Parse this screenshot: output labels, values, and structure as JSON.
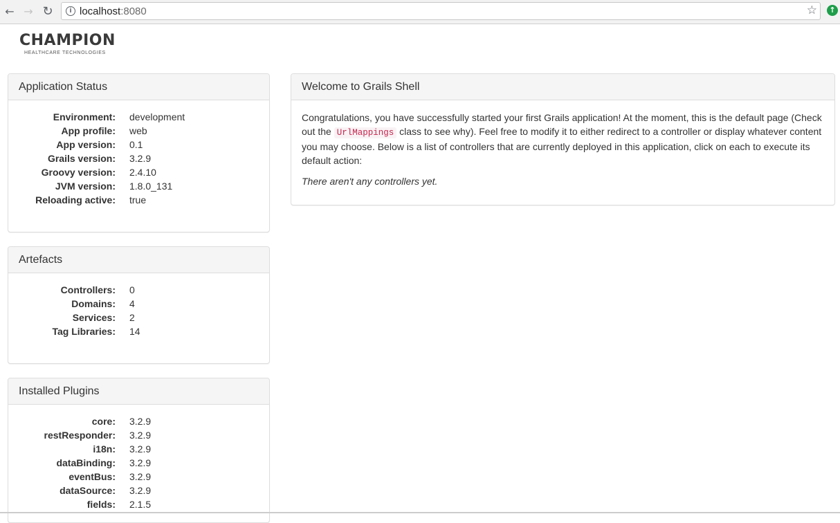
{
  "browser": {
    "url_host": "localhost",
    "url_port": ":8080",
    "back_icon": "←",
    "forward_icon": "→",
    "reload_icon": "↻",
    "info_icon": "i",
    "star_icon": "☆",
    "extension_icon": "↑"
  },
  "logo": {
    "name": "CHAMPION",
    "tagline": "HEALTHCARE TECHNOLOGIES"
  },
  "application_status": {
    "title": "Application Status",
    "items": [
      {
        "label": "Environment:",
        "value": "development"
      },
      {
        "label": "App profile:",
        "value": "web"
      },
      {
        "label": "App version:",
        "value": "0.1"
      },
      {
        "label": "Grails version:",
        "value": "3.2.9"
      },
      {
        "label": "Groovy version:",
        "value": "2.4.10"
      },
      {
        "label": "JVM version:",
        "value": "1.8.0_131"
      },
      {
        "label": "Reloading active:",
        "value": "true"
      }
    ]
  },
  "artefacts": {
    "title": "Artefacts",
    "items": [
      {
        "label": "Controllers:",
        "value": "0"
      },
      {
        "label": "Domains:",
        "value": "4"
      },
      {
        "label": "Services:",
        "value": "2"
      },
      {
        "label": "Tag Libraries:",
        "value": "14"
      }
    ]
  },
  "installed_plugins": {
    "title": "Installed Plugins",
    "items": [
      {
        "label": "core:",
        "value": "3.2.9"
      },
      {
        "label": "restResponder:",
        "value": "3.2.9"
      },
      {
        "label": "i18n:",
        "value": "3.2.9"
      },
      {
        "label": "dataBinding:",
        "value": "3.2.9"
      },
      {
        "label": "eventBus:",
        "value": "3.2.9"
      },
      {
        "label": "dataSource:",
        "value": "3.2.9"
      },
      {
        "label": "fields:",
        "value": "2.1.5"
      }
    ]
  },
  "welcome": {
    "title": "Welcome to Grails Shell",
    "text_before_code": "Congratulations, you have successfully started your first Grails application! At the moment, this is the default page (Check out the ",
    "code": "UrlMappings",
    "text_after_code": " class to see why). Feel free to modify it to either redirect to a controller or display whatever content you may choose. Below is a list of controllers that are currently deployed in this application, click on each to execute its default action:",
    "empty_note": "There aren't any controllers yet."
  }
}
